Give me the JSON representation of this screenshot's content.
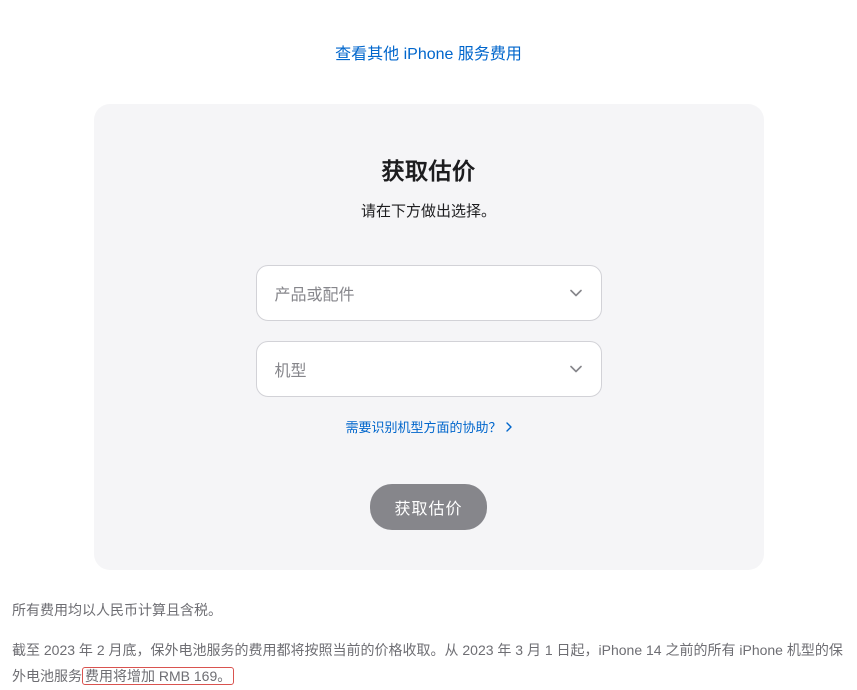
{
  "topLink": {
    "label": "查看其他 iPhone 服务费用"
  },
  "card": {
    "title": "获取估价",
    "subtitle": "请在下方做出选择。",
    "select1": {
      "placeholder": "产品或配件"
    },
    "select2": {
      "placeholder": "机型"
    },
    "helpLink": "需要识别机型方面的协助？",
    "button": "获取估价"
  },
  "footer": {
    "p1": "所有费用均以人民币计算且含税。",
    "p2a": "截至 2023 年 2 月底，保外电池服务的费用都将按照当前的价格收取。从 2023 年 3 月 1 日起，iPhone 14 之前的所有 iPhone 机型的保外电池服务",
    "p2b": "费用将增加 RMB 169。"
  }
}
